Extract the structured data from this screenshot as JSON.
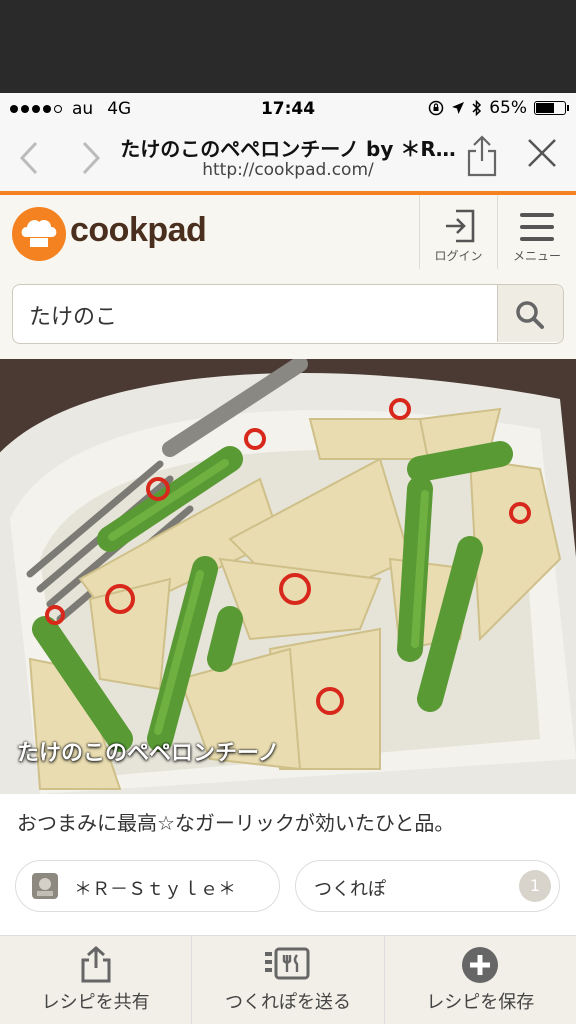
{
  "status_bar": {
    "carrier": "au",
    "network": "4G",
    "time": "17:44",
    "battery": "65%",
    "battery_level": 0.65
  },
  "browser": {
    "title": "たけのこのペペロンチーノ by ＊R…",
    "url": "http://cookpad.com/"
  },
  "header": {
    "logo_text": "cookpad",
    "login_label": "ログイン",
    "menu_label": "メニュー"
  },
  "search": {
    "query": "たけのこ"
  },
  "recipe": {
    "title": "たけのこのペペロンチーノ",
    "description": "おつまみに最高☆なガーリックが効いたひと品。",
    "author": "＊Ｒ－Ｓｔｙｌｅ＊",
    "tsukurepo_label": "つくれぽ",
    "tsukurepo_count": "1"
  },
  "bottom_bar": {
    "share_label": "レシピを共有",
    "send_label": "つくれぽを送る",
    "save_label": "レシピを保存"
  },
  "colors": {
    "accent": "#f58220",
    "brand_text": "#4a2f1f"
  }
}
